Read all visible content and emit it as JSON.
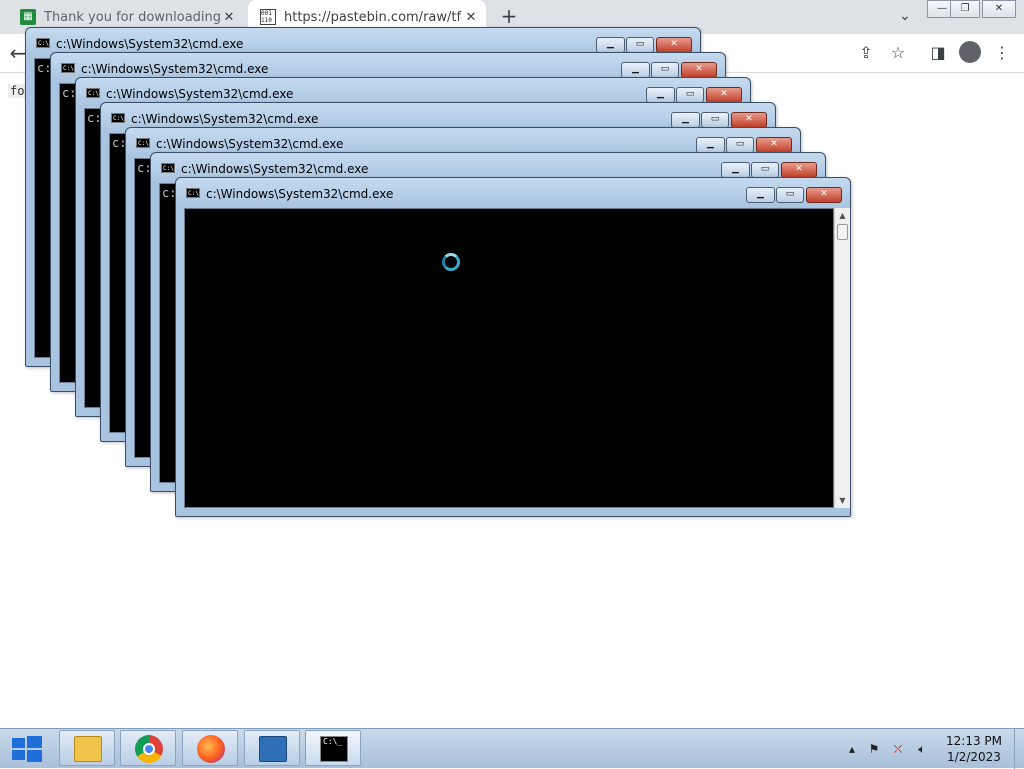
{
  "browser": {
    "tabs": [
      {
        "title": "Thank you for downloading Start",
        "favicon": "spreadsheet-icon",
        "active": false
      },
      {
        "title": "https://pastebin.com/raw/tfaNW",
        "favicon": "binary-file-icon",
        "active": true
      }
    ],
    "new_tab_symbol": "+",
    "favicon_binary_text": "001 110",
    "toolbar_icons": [
      "back-arrow-icon",
      "share-icon",
      "star-icon",
      "sidebar-icon",
      "profile-icon",
      "menu-icon"
    ],
    "page_text": "for"
  },
  "cmd_windows": {
    "title": "c:\\Windows\\System32\\cmd.exe",
    "prompt_text": "c:",
    "icon_text": "C:\\",
    "count": 7
  },
  "taskbar": {
    "apps": [
      "file-explorer-icon",
      "chrome-icon",
      "firefox-icon",
      "network-icon",
      "command-prompt-icon"
    ],
    "active_app": "command-prompt-icon",
    "cmd_icon_text": "C:\\_",
    "clock_time": "12:13 PM",
    "clock_date": "1/2/2023"
  },
  "colors": {
    "cmd_frame": "#a9c4e0",
    "close_button": "#c2402a",
    "spinner": "#3aa8c8"
  }
}
